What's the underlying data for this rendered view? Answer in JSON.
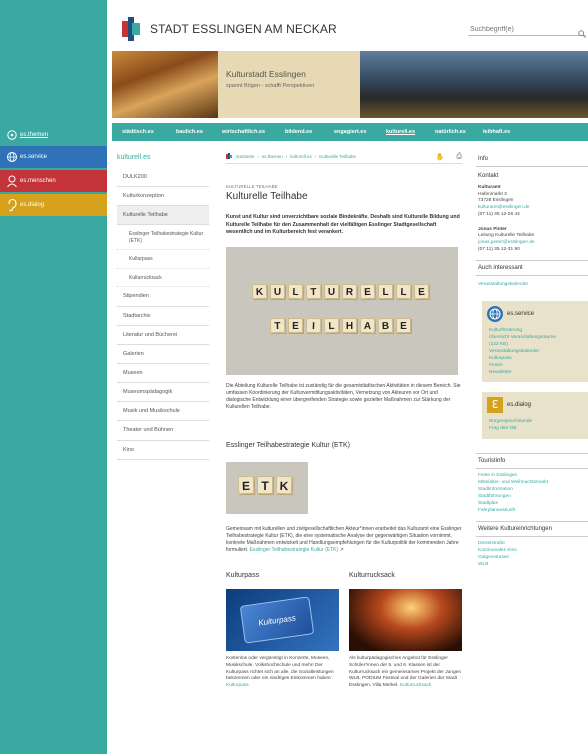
{
  "brand": {
    "site_title": "STADT ESSLINGEN AM NECKAR",
    "accent": "#3aa9a2"
  },
  "search": {
    "placeholder": "Suchbegriff(e)"
  },
  "side_nav": [
    {
      "label": "es.themen",
      "color": "#3aa9a2",
      "icon": "speech-bubble-icon"
    },
    {
      "label": "es.service",
      "color": "#2f72b8",
      "icon": "globe-icon"
    },
    {
      "label": "es.menschen",
      "color": "#c4333a",
      "icon": "person-icon"
    },
    {
      "label": "es.dialog",
      "color": "#d6a11b",
      "icon": "ear-icon"
    }
  ],
  "banner": {
    "title": "Kulturstadt Esslingen",
    "subtitle": "spannt Bögen - schafft Perspektiven"
  },
  "top_nav": [
    "städtisch.es",
    "baulich.es",
    "wirtschaftlich.es",
    "bildend.es",
    "engagiert.es",
    "kulturell.es",
    "natürlich.es",
    "leibhaft.es"
  ],
  "top_nav_active": "kulturell.es",
  "left_nav": {
    "heading": "kulturell.es",
    "items": [
      {
        "label": "DULK200"
      },
      {
        "label": "Kulturkonzeption"
      },
      {
        "label": "Kulturelle Teilhabe",
        "active": true
      },
      {
        "label": "Esslinger Teilhabestrategie Kultur (ETK)",
        "sub": true
      },
      {
        "label": "Kulturpass",
        "sub": true
      },
      {
        "label": "Kulturrucksack",
        "sub": true
      },
      {
        "label": "Stipendien"
      },
      {
        "label": "Stadtarchiv"
      },
      {
        "label": "Literatur und Bücherei"
      },
      {
        "label": "Galerien"
      },
      {
        "label": "Museen"
      },
      {
        "label": "Museumspädagogik"
      },
      {
        "label": "Musik und Musikschule"
      },
      {
        "label": "Theater und Bühnen"
      },
      {
        "label": "Kino"
      }
    ]
  },
  "breadcrumb": [
    "startseite",
    "es.themen",
    "kulturell.es",
    "Kulturelle Teilhabe"
  ],
  "article": {
    "kicker": "KULTURELLE TEILHABE",
    "title": "Kulturelle Teilhabe",
    "lead": "Kunst und Kultur sind unverzichtbare soziale Bindekräfte. Deshalb sind Kulturelle Bildung und Kulturelle Teilhabe für den Zusammenhalt der vielfältigen Esslinger Stadtgesellschaft wesentlich und im Kulturbereich fest verankert.",
    "tiles_row1": [
      "K",
      "U",
      "L",
      "T",
      "U",
      "R",
      "E",
      "L",
      "L",
      "E"
    ],
    "tiles_row2": [
      "T",
      "E",
      "I",
      "L",
      "H",
      "A",
      "B",
      "E"
    ],
    "p1": "Die Abteilung Kulturelle Teilhabe ist zuständig für die gesamtstädtischen Aktivitäten in diesem Bereich. Sie umfassen Koordinierung der Kulturvermittlungsaktivitäten, Vernetzung von Akteuren vor Ort und dialogische Entwicklung einer übergreifenden Strategie sowie gezielter Maßnahmen zur Stärkung der Kulturellen Teilhabe.",
    "etk_heading": "Esslinger Teilhabestrategie Kultur (ETK)",
    "etk_tiles": [
      "E",
      "T",
      "K"
    ],
    "p2": "Gemeinsam mit kulturellen und zivilgesellschaftlichen Akteur*innen erarbeitet das Kulturamt eine Esslinger Teilhabestrategie Kultur (ETK), die eine systematische Analyse der gegenwärtigen Situation vornimmt, konkrete Maßnahmen entwickelt und Handlungsempfehlungen für die Kulturpolitik der kommenden Jahre formuliert.",
    "p2_link": "Esslinger Teilhabestrategie Kultur (ETK)",
    "kp_heading": "Kulturpass",
    "kp_card": "Kulturpass",
    "kp_text": "Kostenlos oder vergünstigt in Konzerte, Museen, Musikschule, Volkshochschule und mehr! Der Kulturpass richtet sich an alle, die Sozialleistungen bekommen oder ein niedriges Einkommen haben:",
    "kp_link": "Kulturpass",
    "kr_heading": "Kulturrucksack",
    "kr_text": "Als kulturpädagogisches Angebot für Esslinger Schüler*innen der 5. und 6. Klassen ist der Kulturrucksack ein gemeinsames Projekt der Jungen WLB, PODIUM Festival und der Galerien der Stadt Esslingen, Villa Merkel.",
    "kr_link": "Kulturrucksack"
  },
  "right": {
    "info": "Info",
    "kontakt": "Kontakt",
    "c1": [
      "Kulturamt",
      "Hafenmarkt 3",
      "73728  Esslingen",
      "kulturamt@esslingen.de",
      "(07 11) 35 12-26 44"
    ],
    "c2": [
      "Jonas Pinter",
      "",
      "Leitung Kulturelle Teilhabe",
      "jonas.pinter@esslingen.de",
      "(07 11) 35 12-31 90"
    ],
    "auch": "Auch interessant",
    "auch_link": "Veranstaltungskalender",
    "service_title": "es.service",
    "service_links": [
      "Kulturförderung",
      "Übersicht Veranstaltungsräume",
      "(222 KB)",
      "Veranstaltungskalender",
      "Kulturpass",
      "Ferien",
      "Newsletter"
    ],
    "dialog_title": "es.dialog",
    "dialog_links": [
      "Bürgersprechstunde",
      "Frag den OB"
    ],
    "touri": "Touristinfo",
    "touri_links": [
      "Feste in Esslingen",
      "Mittelalter- und Weihnachtsmarkt",
      "Stadtinformation",
      "Stadtführungen",
      "Stadtplan",
      "Fahrplanauskunft"
    ],
    "weitere": "Weitere Kultureinrichtungen",
    "weitere_links": [
      "Dieselstraße",
      "Kommunales Kino",
      "Galgenstrasse",
      "WLB"
    ]
  }
}
